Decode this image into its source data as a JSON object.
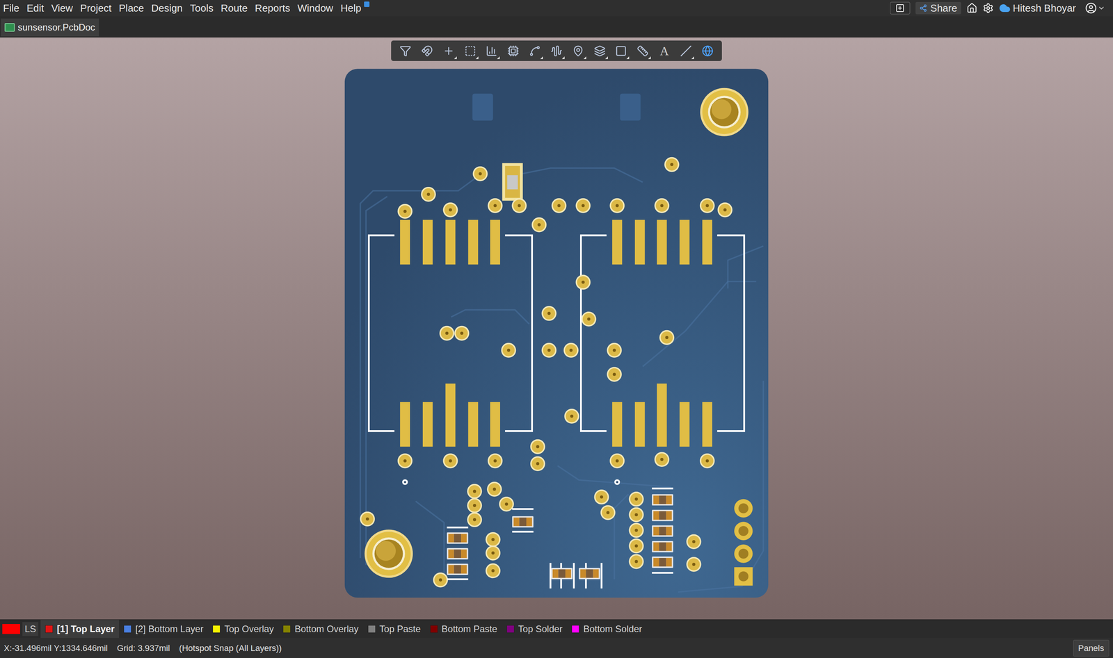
{
  "window": {
    "title": "sunsensor.PcbDoc"
  },
  "menu": [
    "File",
    "Edit",
    "View",
    "Project",
    "Place",
    "Design",
    "Tools",
    "Route",
    "Reports",
    "Window",
    "Help"
  ],
  "header": {
    "share": "Share",
    "user": "Hitesh Bhoyar"
  },
  "document_tabs": [
    {
      "label": "sunsensor.PcbDoc",
      "selected": true
    }
  ],
  "toolbar": [
    {
      "kind": "icon",
      "dropdown": false
    },
    {
      "kind": "icon",
      "dropdown": false
    },
    {
      "kind": "icon",
      "dropdown": true
    },
    {
      "kind": "icon",
      "dropdown": true
    },
    {
      "kind": "icon",
      "dropdown": true
    },
    {
      "kind": "icon",
      "dropdown": false
    },
    {
      "kind": "icon",
      "dropdown": true
    },
    {
      "kind": "icon",
      "dropdown": true
    },
    {
      "kind": "icon",
      "dropdown": true
    },
    {
      "kind": "icon",
      "dropdown": true
    },
    {
      "kind": "icon",
      "dropdown": true
    },
    {
      "kind": "icon",
      "dropdown": true
    },
    {
      "kind": "glyph",
      "text": "A",
      "dropdown": false
    },
    {
      "kind": "icon",
      "dropdown": true
    },
    {
      "kind": "icon",
      "dropdown": false
    }
  ],
  "layer_set": {
    "label": "LS",
    "color": "#ff0000"
  },
  "layers": [
    {
      "label": "[1] Top Layer",
      "color": "#e01414",
      "selected": true
    },
    {
      "label": "[2] Bottom Layer",
      "color": "#4a7fe0",
      "selected": false
    },
    {
      "label": "Top Overlay",
      "color": "#f5f200",
      "selected": false
    },
    {
      "label": "Bottom Overlay",
      "color": "#848200",
      "selected": false
    },
    {
      "label": "Top Paste",
      "color": "#808080",
      "selected": false
    },
    {
      "label": "Bottom Paste",
      "color": "#800000",
      "selected": false
    },
    {
      "label": "Top Solder",
      "color": "#800080",
      "selected": false
    },
    {
      "label": "Bottom Solder",
      "color": "#ff00ff",
      "selected": false
    }
  ],
  "status_bar": {
    "coords": "X:-31.496mil Y:1334.646mil",
    "grid": "Grid: 3.937mil",
    "snap": "(Hotspot Snap (All Layers))",
    "panels": "Panels"
  }
}
